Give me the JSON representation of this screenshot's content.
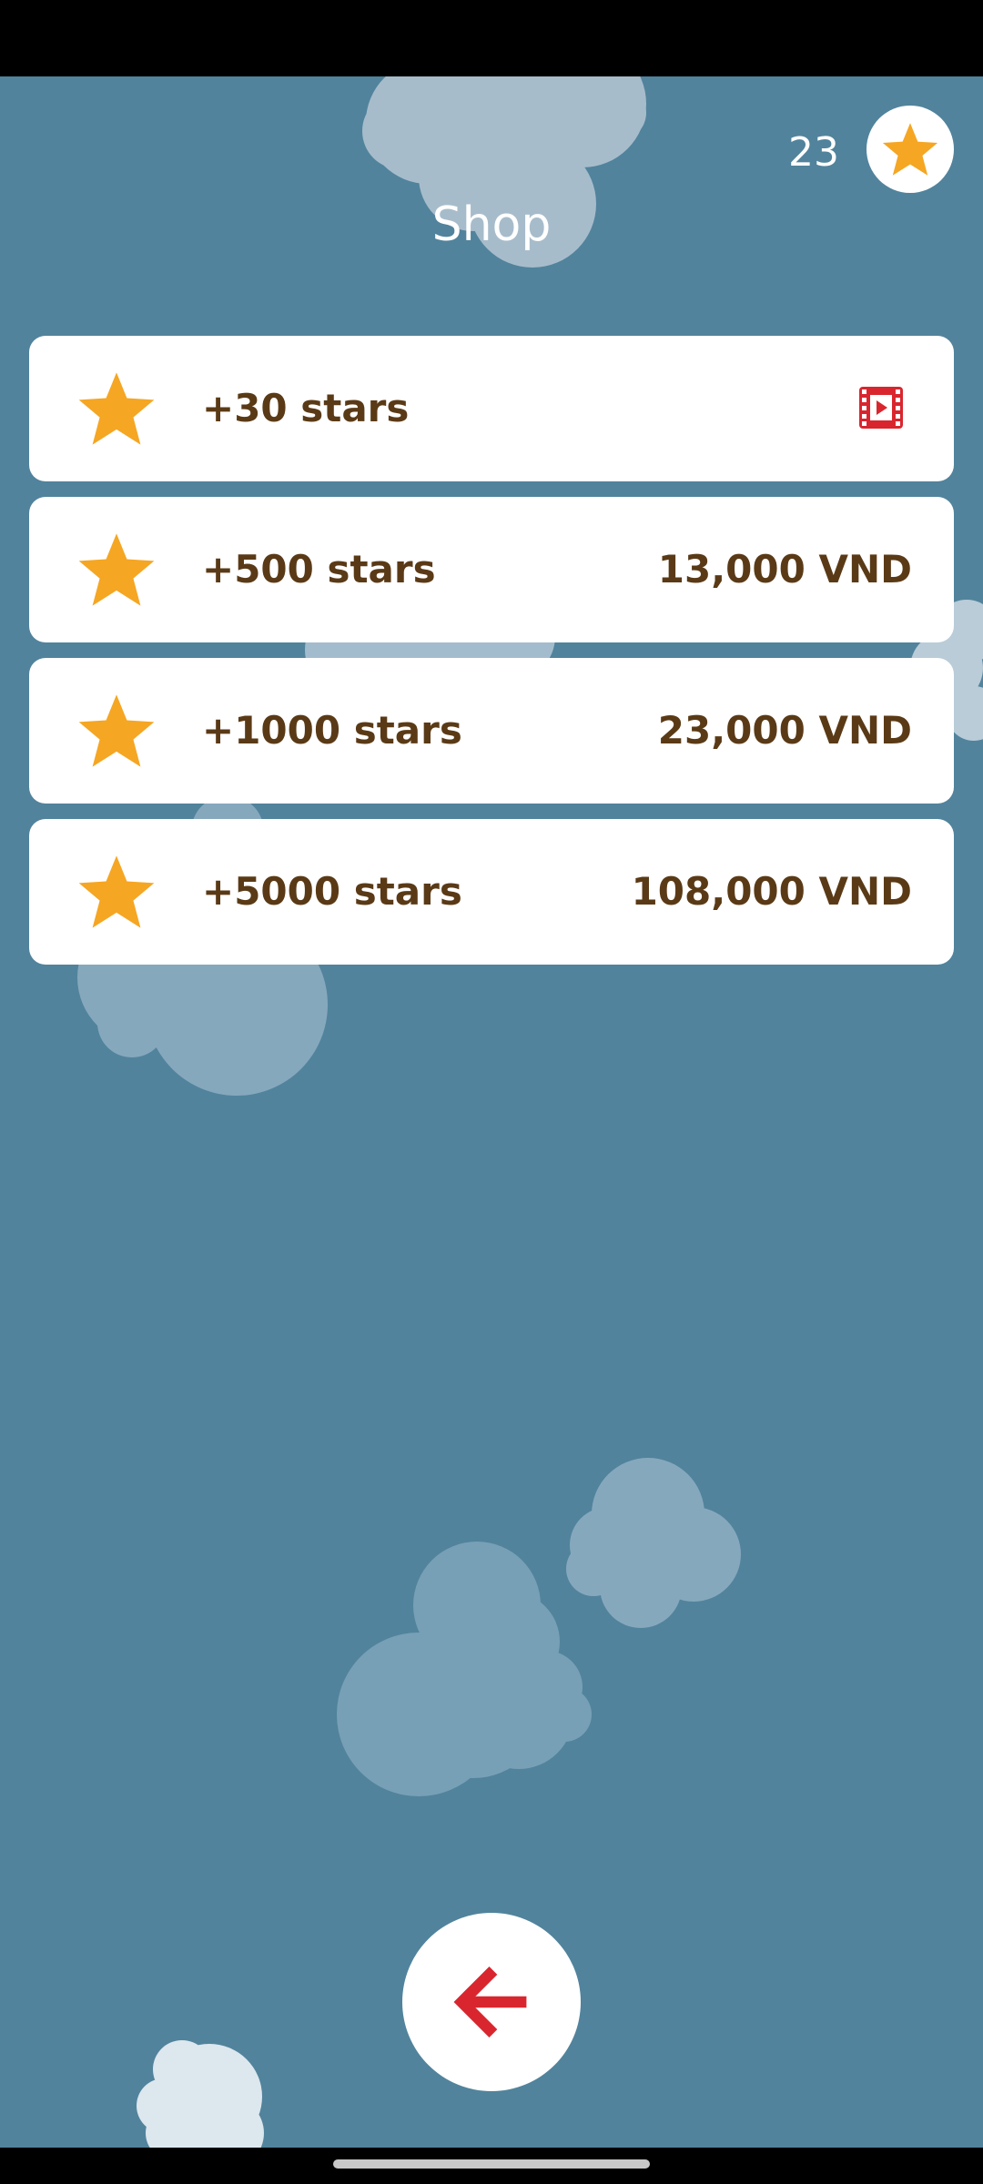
{
  "header": {
    "star_count": "23",
    "title": "Shop"
  },
  "shop_items": [
    {
      "label": "+30 stars",
      "price": "",
      "action_icon": "video-ad-icon"
    },
    {
      "label": "+500 stars",
      "price": "13,000 VND"
    },
    {
      "label": "+1000 stars",
      "price": "23,000 VND"
    },
    {
      "label": "+5000 stars",
      "price": "108,000 VND"
    }
  ],
  "icons": {
    "star": "star-icon",
    "video": "video-ad-icon",
    "back": "back-arrow-icon"
  },
  "colors": {
    "background": "#51839c",
    "card": "#ffffff",
    "item_text": "#5a3a16",
    "star": "#f5a623",
    "video_icon": "#d9262e",
    "back_arrow": "#d9262e"
  }
}
